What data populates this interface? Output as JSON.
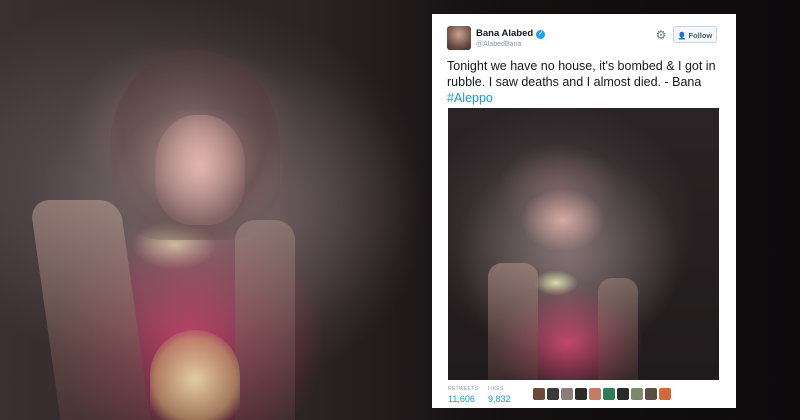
{
  "tweet": {
    "display_name": "Bana Alabed",
    "handle": "@AlabedBana",
    "follow_label": "Follow",
    "text_main": "Tonight we have no house, it's bombed & I got in rubble. I saw deaths and I almost died. - Bana ",
    "hashtag": "#Aleppo",
    "stats": {
      "retweets_label": "RETWEETS",
      "retweets": "11,606",
      "likes_label": "LIKES",
      "likes": "9,832"
    }
  },
  "colors": {
    "accent": "#1b95e0",
    "verified": "#1da1f2",
    "text": "#14171a",
    "muted": "#8899a6"
  },
  "icons": {
    "verified": "verified-badge-icon",
    "settings": "gear-icon",
    "follow": "add-user-icon"
  },
  "liker_avatars": [
    "#6b4a3a",
    "#3a3a3a",
    "#8a7d78",
    "#2d2a2a",
    "#c47b63",
    "#2f7d56",
    "#2b2b2b",
    "#7a8a6b",
    "#5a4f45",
    "#d2693a"
  ]
}
